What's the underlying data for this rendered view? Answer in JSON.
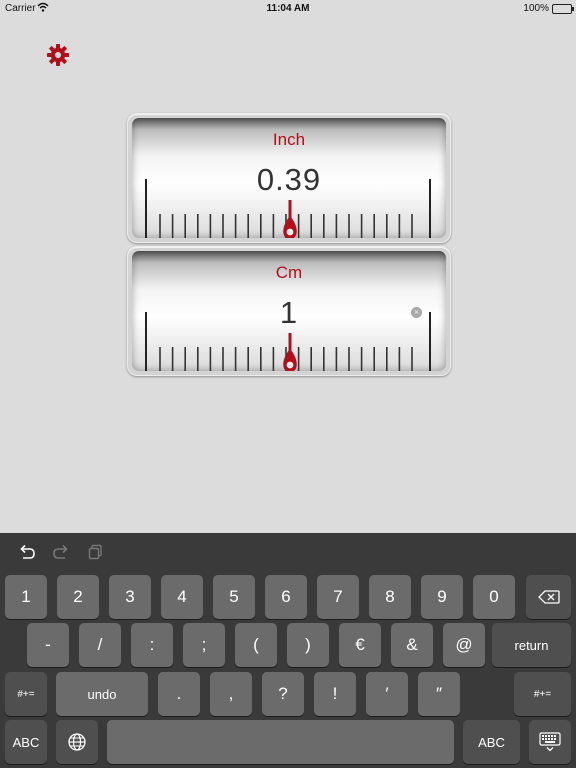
{
  "status": {
    "carrier": "Carrier",
    "time": "11:04 AM",
    "battery": "100%",
    "battery_level": 1.0
  },
  "settings_icon": "gear-icon",
  "accent_color": "#b0101c",
  "top_ruler": {
    "unit": "Inch",
    "value": "0.39"
  },
  "bottom_ruler": {
    "unit": "Cm",
    "value": "1"
  },
  "keyboard": {
    "toolbar": [
      "undo-icon",
      "redo-icon",
      "paste-icon"
    ],
    "row1": [
      "1",
      "2",
      "3",
      "4",
      "5",
      "6",
      "7",
      "8",
      "9",
      "0"
    ],
    "row2": [
      "-",
      "/",
      ":",
      ";",
      "(",
      ")",
      "€",
      "&",
      "@"
    ],
    "return_label": "return",
    "row3_left": "#+=",
    "undo_label": "undo",
    "row3": [
      ".",
      ",",
      "?",
      "!",
      "′",
      "″"
    ],
    "row3_right": "#+=",
    "abc_left": "ABC",
    "abc_right": "ABC"
  }
}
